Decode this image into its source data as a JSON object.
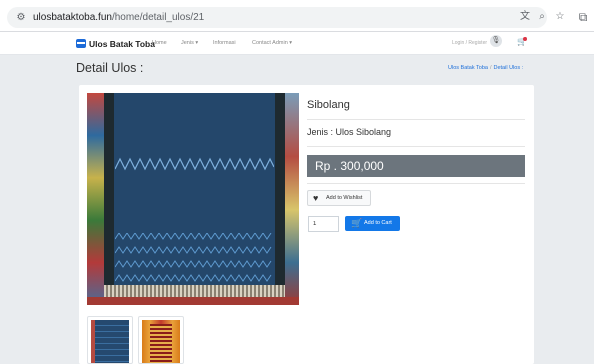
{
  "browser": {
    "url_host": "ulosbataktoba.fun",
    "url_path": "/home/detail_ulos/21",
    "icons": [
      "site-info-icon",
      "translate-icon",
      "zoom-icon",
      "bookmark-star-icon",
      "extensions-icon"
    ]
  },
  "navbar": {
    "brand": "Ulos Batak Toba",
    "items": [
      {
        "label": "Home"
      },
      {
        "label": "Jenis ▾"
      },
      {
        "label": "Informasi"
      },
      {
        "label": "Contact Admin ▾"
      }
    ],
    "login_label": "Login / Register",
    "icons": [
      "mic-icon",
      "cart-icon"
    ]
  },
  "page": {
    "title": "Detail Ulos :",
    "breadcrumb": {
      "home": "Ulos Batak Toba",
      "separator": "/",
      "current": "Detail Ulos :"
    }
  },
  "product": {
    "name": "Sibolang",
    "jenis": "Jenis : Ulos Sibolang",
    "price": "Rp . 300,000",
    "wishlist_label": "Add to Wishlist",
    "quantity": "1",
    "add_to_cart_label": "Add to Cart"
  },
  "colors": {
    "primary": "#1378e8",
    "price_bg": "#6c757d",
    "page_bg": "#e9ecef"
  }
}
